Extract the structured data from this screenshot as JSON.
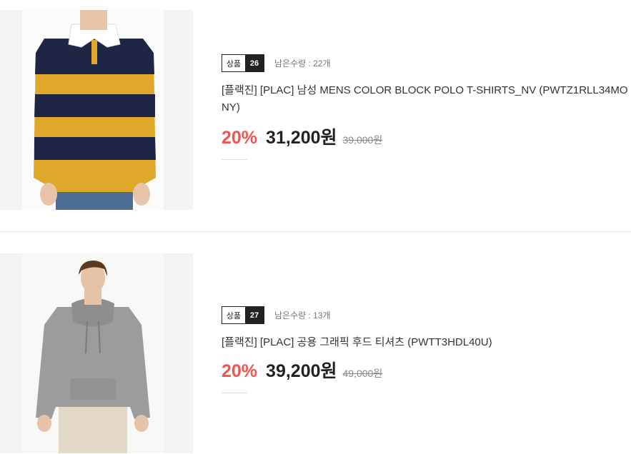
{
  "products": [
    {
      "tag_label": "상품",
      "tag_number": "26",
      "stock": "남은수량 : 22개",
      "title": "[플랙진] [PLAC] 남성 MENS COLOR BLOCK POLO T-SHIRTS_NV (PWTZ1RLL34MONY)",
      "discount": "20%",
      "price": "31,200원",
      "original_price": "39,000원",
      "image_description": "striped rugby polo shirt navy and mustard"
    },
    {
      "tag_label": "상품",
      "tag_number": "27",
      "stock": "남은수량 : 13개",
      "title": "[플랙진] [PLAC] 공용 그래픽 후드 티셔츠 (PWTT3HDL40U)",
      "discount": "20%",
      "price": "39,200원",
      "original_price": "49,000원",
      "image_description": "grey hooded sweatshirt"
    }
  ],
  "colors": {
    "discount": "#f0554f",
    "navy": "#1f2544",
    "mustard": "#e0a82a",
    "hoodie_grey": "#9c9c9c"
  }
}
